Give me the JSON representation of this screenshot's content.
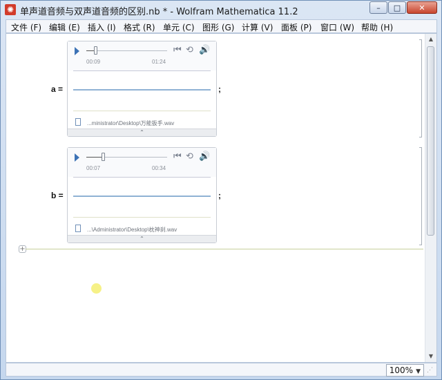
{
  "window": {
    "title": "单声道音频与双声道音频的区别.nb * - Wolfram Mathematica 11.2",
    "buttons": {
      "minimize": "–",
      "maximize": "□",
      "close": "✕"
    }
  },
  "menu": [
    "文件 (F)",
    "编辑 (E)",
    "插入 (I)",
    "格式 (R)",
    "单元 (C)",
    "图形 (G)",
    "计算 (V)",
    "面板 (P)",
    "窗口 (W)",
    "帮助 (H)"
  ],
  "cells": [
    {
      "label": "a =",
      "semicolon": ";",
      "audio": {
        "current_time": "00:09",
        "duration": "01:24",
        "progress": 0.107,
        "file": "...ministrator\\Desktop\\万能扳手.wav",
        "collapse": "⌃"
      }
    },
    {
      "label": "b =",
      "semicolon": ";",
      "audio": {
        "current_time": "00:07",
        "duration": "00:34",
        "progress": 0.206,
        "file": "...\\Administrator\\Desktop\\枕神刹.wav",
        "collapse": "⌃"
      }
    }
  ],
  "status": {
    "zoom": "100%",
    "dropdown": "▼"
  },
  "insert": {
    "plus": "+"
  },
  "colors": {
    "accent": "#3c72b5",
    "waveform": "#8fb2d4",
    "cursor": "#f5f07a"
  }
}
